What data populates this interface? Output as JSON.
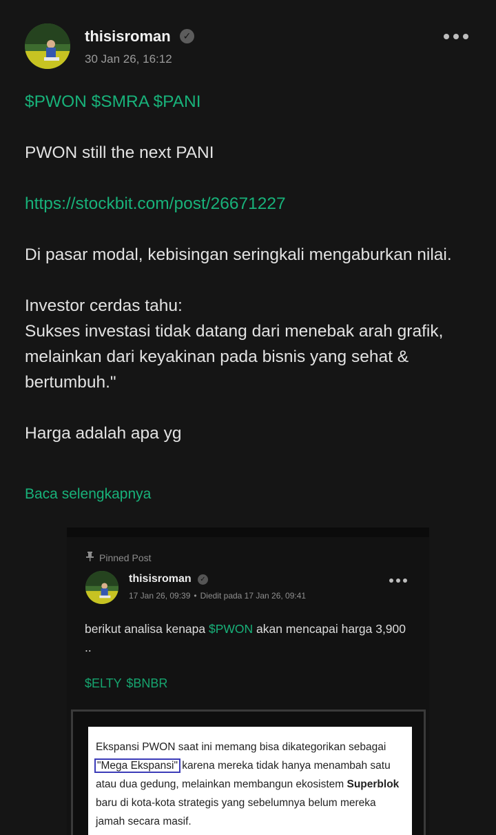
{
  "author": {
    "username": "thisisroman",
    "verified_icon": "check",
    "timestamp": "30 Jan 26, 16:12"
  },
  "post": {
    "tickers": "$PWON $SMRA $PANI",
    "line1": "PWON still the next PANI",
    "link": "https://stockbit.com/post/26671227",
    "para1": "Di pasar modal, kebisingan seringkali mengaburkan nilai.",
    "para2_line1": "Investor cerdas tahu:",
    "para2_line2": "Sukses investasi tidak datang dari menebak arah grafik, melainkan dari keyakinan pada bisnis yang sehat & bertumbuh.\"",
    "para3": "Harga adalah apa yg",
    "read_more": "Baca selengkapnya"
  },
  "embedded": {
    "pinned_label": "Pinned Post",
    "username": "thisisroman",
    "posted": "17 Jan 26, 09:39",
    "separator": "•",
    "edited": "Diedit pada 17 Jan 26, 09:41",
    "text_before": "berikut analisa kenapa ",
    "text_ticker": "$PWON",
    "text_after": " akan mencapai harga 3,900 ..",
    "tags": "$ELTY $BNBR",
    "doc": {
      "t1": "Ekspansi PWON saat ini memang bisa dikategorikan sebagai ",
      "highlight": "\"Mega Ekspansi\"",
      "t2": " karena mereka tidak hanya menambah satu atau dua gedung, melainkan membangun ekosistem ",
      "bold": "Superblok",
      "t3": " baru di kota-kota strategis yang sebelumnya belum mereka jamah secara masif."
    }
  },
  "colors": {
    "background": "#151515",
    "accent_green": "#18b27a",
    "text": "#e2e2e2",
    "muted": "#9b9b9b"
  }
}
